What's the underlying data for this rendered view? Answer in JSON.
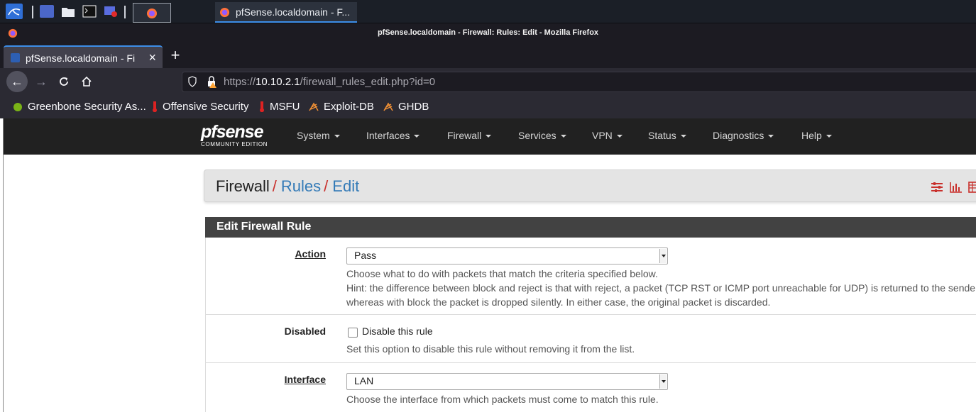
{
  "taskbar": {
    "task_title": "pfSense.localdomain - F...",
    "icons": [
      "kali-menu-icon",
      "workspace-icon",
      "file-manager-icon",
      "terminal-icon",
      "screen-recorder-icon",
      "firefox-icon"
    ]
  },
  "window": {
    "title": "pfSense.localdomain - Firewall: Rules: Edit - Mozilla Firefox"
  },
  "browser": {
    "tab_title": "pfSense.localdomain - Fi",
    "url_prefix": "https://",
    "url_host": "10.10.2.1",
    "url_path": "/firewall_rules_edit.php?id=0",
    "bookmarks": [
      {
        "label": "Greenbone Security As..."
      },
      {
        "label": "Offensive Security"
      },
      {
        "label": "MSFU"
      },
      {
        "label": "Exploit-DB"
      },
      {
        "label": "GHDB"
      }
    ]
  },
  "pfsense": {
    "logo_word": "pfsense",
    "logo_sub": "COMMUNITY EDITION",
    "menu": [
      "System",
      "Interfaces",
      "Firewall",
      "Services",
      "VPN",
      "Status",
      "Diagnostics",
      "Help"
    ],
    "breadcrumb": {
      "root": "Firewall",
      "sep": "/",
      "rules": "Rules",
      "edit": "Edit"
    },
    "panel_title": "Edit Firewall Rule",
    "rows": {
      "action": {
        "label": "Action",
        "value": "Pass",
        "help1": "Choose what to do with packets that match the criteria specified below.",
        "help2": "Hint: the difference between block and reject is that with reject, a packet (TCP RST or ICMP port unreachable for UDP) is returned to the sender,",
        "help3": "whereas with block the packet is dropped silently. In either case, the original packet is discarded."
      },
      "disabled": {
        "label": "Disabled",
        "checkbox_label": "Disable this rule",
        "checked": false,
        "help": "Set this option to disable this rule without removing it from the list."
      },
      "interface": {
        "label": "Interface",
        "value": "LAN",
        "help": "Choose the interface from which packets must come to match this rule."
      }
    }
  },
  "colors": {
    "pf_navbar": "#212121",
    "pf_accent_red": "#c9302c",
    "link_blue": "#337ab7",
    "panel_header": "#424242"
  }
}
